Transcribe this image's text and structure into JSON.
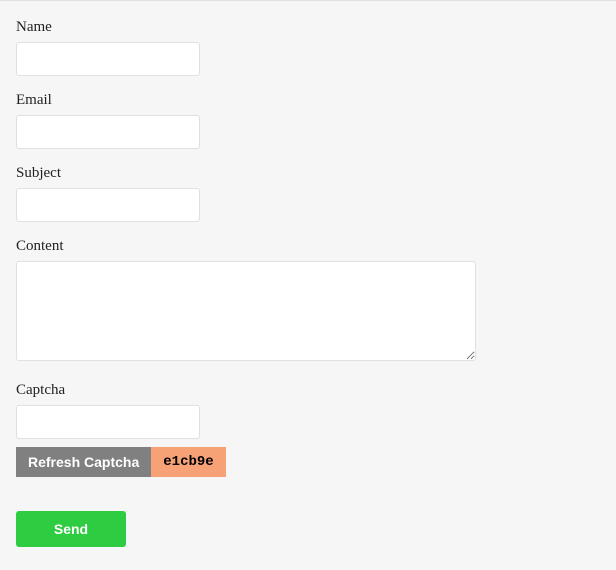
{
  "form": {
    "name_label": "Name",
    "email_label": "Email",
    "subject_label": "Subject",
    "content_label": "Content",
    "captcha_label": "Captcha",
    "refresh_captcha_label": "Refresh Captcha",
    "captcha_value": "e1cb9e",
    "send_label": "Send"
  }
}
